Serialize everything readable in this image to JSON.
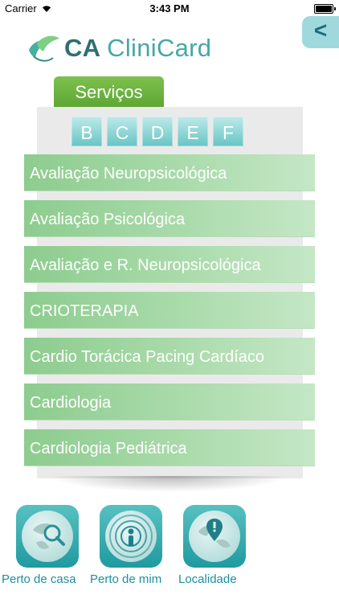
{
  "status_bar": {
    "carrier": "Carrier",
    "time": "3:43 PM"
  },
  "header": {
    "logo_ca": "CA",
    "logo_cliniCard": "CliniCard",
    "back_label": "<"
  },
  "services_tab": {
    "label": "Serviços"
  },
  "letters": [
    "B",
    "C",
    "D",
    "E",
    "F"
  ],
  "items": [
    "Avaliação Neuropsicológica",
    "Avaliação Psicológica",
    "Avaliação e R. Neuropsicológica",
    "CRIOTERAPIA",
    "Cardio Torácica Pacing Cardíaco",
    "Cardiologia",
    "Cardiologia Pediátrica"
  ],
  "bottom_nav": {
    "home": {
      "label": "Perto de casa",
      "icon": "globe-search-icon"
    },
    "me": {
      "label": "Perto de mim",
      "icon": "broadcast-person-icon"
    },
    "locality": {
      "label": "Localidade",
      "icon": "globe-pin-icon"
    }
  },
  "colors": {
    "accent_teal": "#46a7a6",
    "green_tab": "#6ab33f",
    "list_green": "#9ed59f"
  }
}
